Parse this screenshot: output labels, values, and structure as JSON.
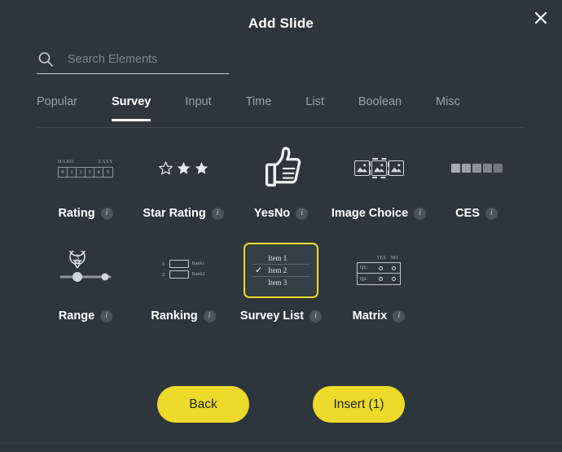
{
  "dialog": {
    "title": "Add Slide",
    "close_icon": "close-icon"
  },
  "search": {
    "icon": "search-icon",
    "placeholder": "Search Elements",
    "value": ""
  },
  "tabs": [
    {
      "label": "Popular",
      "active": false
    },
    {
      "label": "Survey",
      "active": true
    },
    {
      "label": "Input",
      "active": false
    },
    {
      "label": "Time",
      "active": false
    },
    {
      "label": "List",
      "active": false
    },
    {
      "label": "Boolean",
      "active": false
    },
    {
      "label": "Misc",
      "active": false
    }
  ],
  "elements": {
    "rating": {
      "label": "Rating",
      "info": "i",
      "icon": "rating-scale-icon",
      "left_label": "HARD",
      "right_label": "EASY",
      "boxes": [
        "0",
        "1",
        "2",
        "3",
        "4",
        "5"
      ]
    },
    "star_rating": {
      "label": "Star Rating",
      "info": "i",
      "icon": "star-rating-icon",
      "stars": [
        "empty",
        "filled",
        "filled"
      ]
    },
    "yesno": {
      "label": "YesNo",
      "info": "i",
      "icon": "thumbs-up-icon"
    },
    "image_choice": {
      "label": "Image Choice",
      "info": "i",
      "icon": "image-choice-icon",
      "images": [
        "unselected",
        "selected",
        "unselected"
      ]
    },
    "ces": {
      "label": "CES",
      "info": "i",
      "icon": "ces-scale-icon",
      "swatches": [
        "#a7aeb2",
        "#9aa1a6",
        "#8d9499",
        "#7e858a",
        "#71787d"
      ]
    },
    "range": {
      "label": "Range",
      "info": "i",
      "icon": "range-slider-icon",
      "tooltip_value": "3"
    },
    "ranking": {
      "label": "Ranking",
      "info": "i",
      "icon": "ranking-icon",
      "rows": [
        {
          "num": "1:",
          "name": "Rank1"
        },
        {
          "num": "2:",
          "name": "Rank2"
        }
      ]
    },
    "survey_list": {
      "label": "Survey List",
      "info": "i",
      "icon": "survey-list-icon",
      "selected": true,
      "rows": [
        {
          "check": "",
          "text": "Item 1"
        },
        {
          "check": "✓",
          "text": "Item 2"
        },
        {
          "check": "",
          "text": "Item 3"
        }
      ]
    },
    "matrix": {
      "label": "Matrix",
      "info": "i",
      "icon": "matrix-icon",
      "columns": [
        "YES",
        "NO"
      ],
      "rows": [
        "Q1:",
        "Q2:"
      ]
    }
  },
  "footer": {
    "back_label": "Back",
    "insert_label": "Insert (1)"
  },
  "colors": {
    "background": "#2c363c",
    "accent": "#edda2a",
    "text": "#ffffff",
    "muted": "#9aa3a9"
  }
}
